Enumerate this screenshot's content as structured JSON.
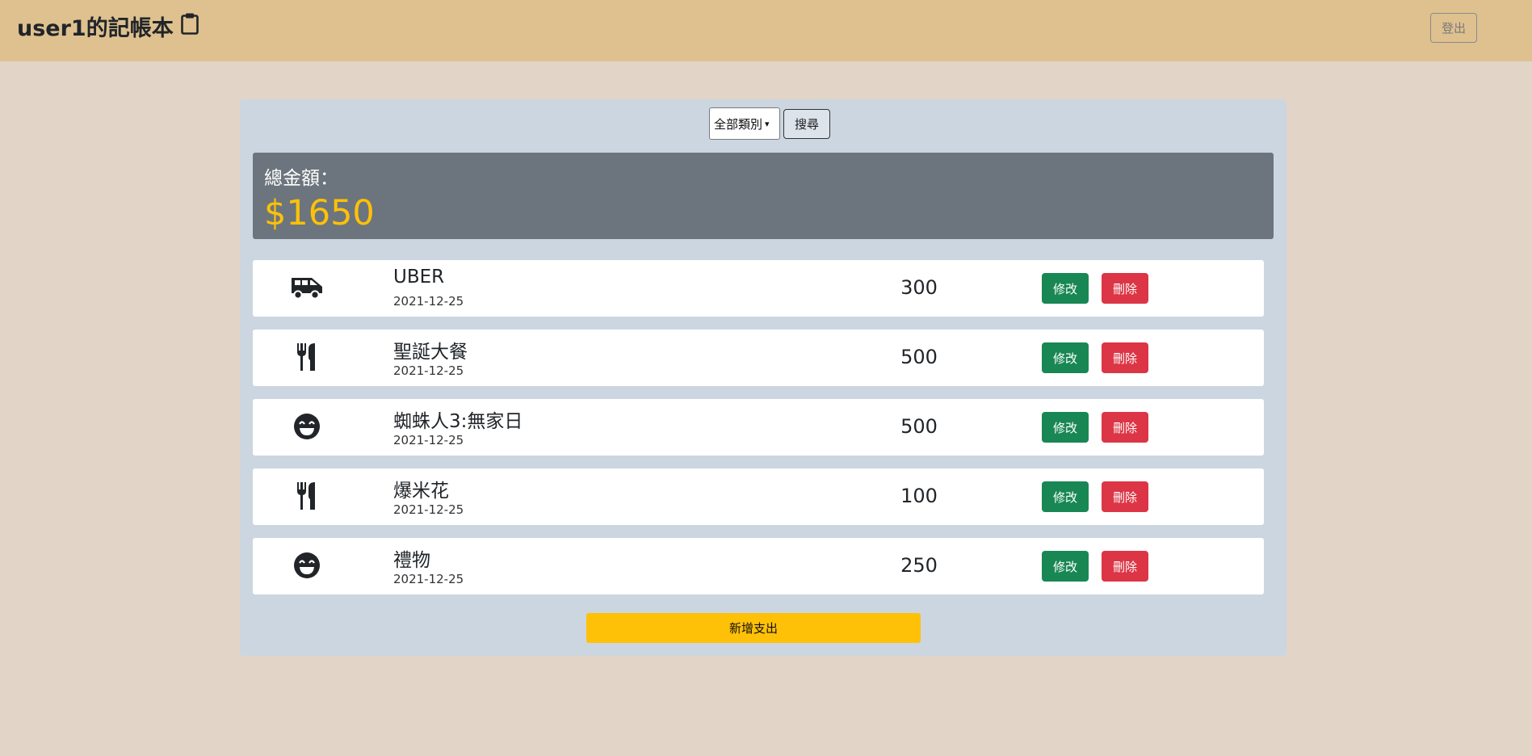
{
  "header": {
    "title": "user1的記帳本",
    "title_icon": "clipboard-icon",
    "logout_label": "登出"
  },
  "filter": {
    "category_selected": "全部類別",
    "search_label": "搜尋"
  },
  "total": {
    "label": "總金額：",
    "amount": "$1650"
  },
  "records": [
    {
      "icon": "van-icon",
      "name": "UBER",
      "date": "2021-12-25",
      "amount": "300",
      "edit_label": "修改",
      "delete_label": "刪除"
    },
    {
      "icon": "utensils-icon",
      "name": "聖誕大餐",
      "date": "2021-12-25",
      "amount": "500",
      "edit_label": "修改",
      "delete_label": "刪除"
    },
    {
      "icon": "smile-icon",
      "name": "蜘蛛人3:無家日",
      "date": "2021-12-25",
      "amount": "500",
      "edit_label": "修改",
      "delete_label": "刪除"
    },
    {
      "icon": "utensils-icon",
      "name": "爆米花",
      "date": "2021-12-25",
      "amount": "100",
      "edit_label": "修改",
      "delete_label": "刪除"
    },
    {
      "icon": "smile-icon",
      "name": "禮物",
      "date": "2021-12-25",
      "amount": "250",
      "edit_label": "修改",
      "delete_label": "刪除"
    }
  ],
  "add_label": "新增支出",
  "colors": {
    "navbar": "#dec18f",
    "background": "#e2d5c7",
    "panel": "#ccd6e0",
    "total_box": "#6c757d",
    "total_amount": "#ffc107",
    "edit_button": "#198754",
    "delete_button": "#dc3545",
    "add_button": "#ffc107"
  }
}
